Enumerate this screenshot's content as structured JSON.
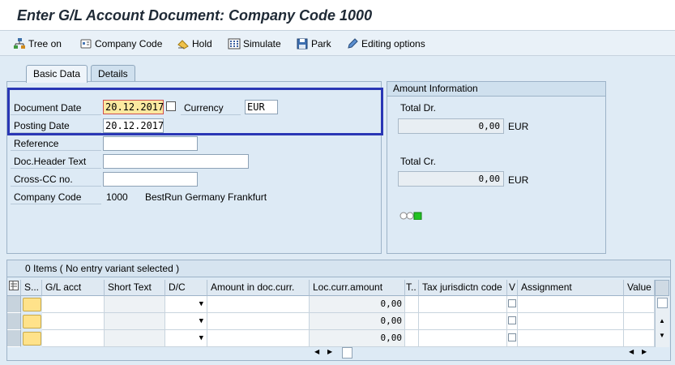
{
  "window": {
    "title": "Enter G/L Account Document: Company Code 1000"
  },
  "toolbar": {
    "tree_on": "Tree on",
    "company_code": "Company Code",
    "hold": "Hold",
    "simulate": "Simulate",
    "park": "Park",
    "editing_options": "Editing options"
  },
  "tabs": {
    "basic": "Basic Data",
    "details": "Details"
  },
  "basic": {
    "document_date_label": "Document Date",
    "document_date": "20.12.2017",
    "currency_label": "Currency",
    "currency": "EUR",
    "posting_date_label": "Posting Date",
    "posting_date": "20.12.2017",
    "reference_label": "Reference",
    "reference": "",
    "doc_header_label": "Doc.Header Text",
    "doc_header": "",
    "cross_cc_label": "Cross-CC no.",
    "cross_cc": "",
    "company_code_label": "Company Code",
    "company_code": "1000",
    "company_name": "BestRun Germany Frankfurt"
  },
  "amount": {
    "header": "Amount Information",
    "total_dr_label": "Total Dr.",
    "total_dr": "0,00",
    "total_dr_currency": "EUR",
    "total_cr_label": "Total Cr.",
    "total_cr": "0,00",
    "total_cr_currency": "EUR",
    "status_lights": "traffic-light-green"
  },
  "items": {
    "title": "0 Items ( No entry variant selected )",
    "columns": {
      "s": "S...",
      "gl_acct": "G/L acct",
      "short_text": "Short Text",
      "dc": "D/C",
      "amount_doc": "Amount in doc.curr.",
      "loc_amount": "Loc.curr.amount",
      "t": "T..",
      "tax_jur": "Tax jurisdictn code",
      "v": "V",
      "assignment": "Assignment",
      "value": "Value"
    },
    "rows": [
      {
        "loc_amount": "0,00"
      },
      {
        "loc_amount": "0,00"
      },
      {
        "loc_amount": "0,00"
      }
    ]
  },
  "colors": {
    "highlight_border": "#2a37b5",
    "status_green": "#22c322"
  }
}
